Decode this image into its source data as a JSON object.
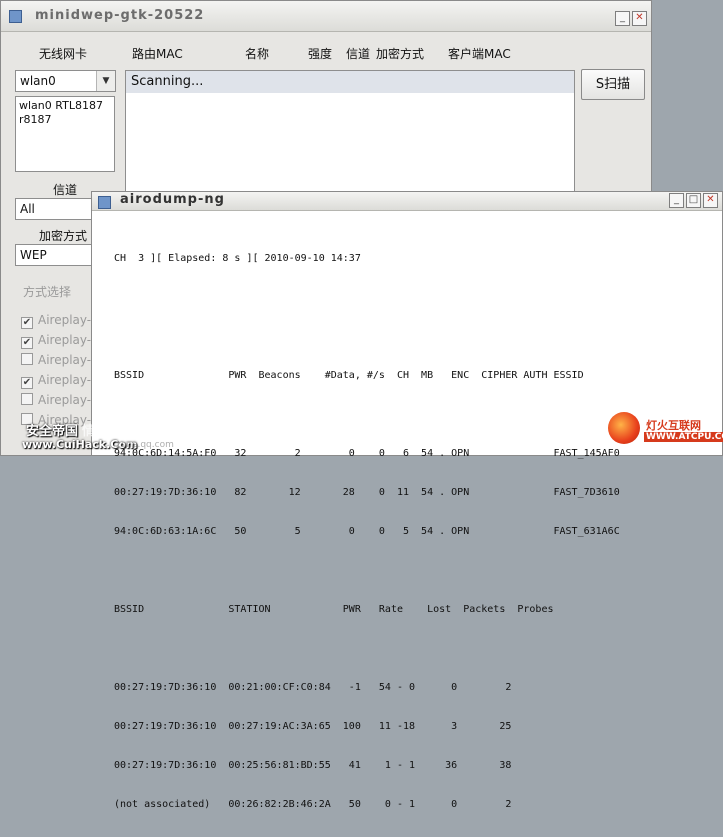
{
  "main_window": {
    "title": "minidwep-gtk-20522",
    "controls": {
      "minimize": "_",
      "maximize": "□",
      "close": "✕"
    },
    "headers": [
      "无线网卡",
      "路由MAC",
      "名称",
      "强度",
      "信道",
      "加密方式",
      "客户端MAC"
    ],
    "interface_select": "wlan0",
    "interface_list": [
      "wlan0 RTL8187",
      "r8187"
    ],
    "scan_status": "Scanning...",
    "scan_button": "S扫描",
    "channel_label": "信道",
    "channel_select": "All",
    "encryption_label": "加密方式",
    "encryption_select": "WEP",
    "method_group_title": "方式选择",
    "methods": [
      {
        "label": "Aireplay-",
        "checked": true
      },
      {
        "label": "Aireplay-",
        "checked": true
      },
      {
        "label": "Aireplay-",
        "checked": false
      },
      {
        "label": "Aireplay-",
        "checked": true
      },
      {
        "label": "Aireplay-",
        "checked": false
      },
      {
        "label": "Aireplay-",
        "checked": false
      }
    ]
  },
  "airodump_window": {
    "title": "airodump-ng",
    "controls": {
      "minimize": "_",
      "maximize": "□",
      "close": "✕"
    },
    "status_line": "CH  3 ][ Elapsed: 8 s ][ 2010-09-10 14:37",
    "ap_header": "BSSID              PWR  Beacons    #Data, #/s  CH  MB   ENC  CIPHER AUTH ESSID",
    "ap_rows": [
      "94:0C:6D:14:5A:F0   32        2        0    0   6  54 . OPN              FAST_145AF0",
      "00:27:19:7D:36:10   82       12       28    0  11  54 . OPN              FAST_7D3610",
      "94:0C:6D:63:1A:6C   50        5        0    0   5  54 . OPN              FAST_631A6C"
    ],
    "station_header": "BSSID              STATION            PWR   Rate    Lost  Packets  Probes",
    "station_rows": [
      "00:27:19:7D:36:10  00:21:00:CF:C0:84   -1   54 - 0      0        2",
      "00:27:19:7D:36:10  00:27:19:AC:3A:65  100   11 -18      3       25",
      "00:27:19:7D:36:10  00:25:56:81:BD:55   41    1 - 1     36       38",
      "(not associated)   00:26:82:2B:46:2A   50    0 - 1      0        2"
    ]
  },
  "watermark_left": {
    "line1": "安全帝国",
    "line1b": "情系雅致",
    "line2": "www.CuiHack.Com",
    "line2b": "zone.qq.com"
  },
  "watermark_right": {
    "line1": "灯火互联网",
    "line2": "WWW.ATCPU.COM"
  }
}
